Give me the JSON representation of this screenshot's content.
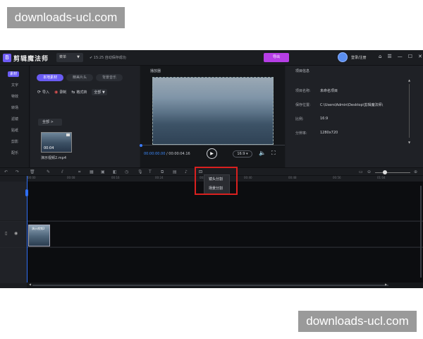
{
  "watermark": {
    "top": "downloads-ucl.com",
    "bottom": "downloads-ucl.com"
  },
  "app": {
    "logo_glyph": "B",
    "title": "剪辑魔法师",
    "menu_label": "菜单",
    "menu_arrow": "▼",
    "autosave": "✔ 15:25 自动保存成功",
    "export_label": "导出",
    "login_label": "登录/注册",
    "window_buttons": [
      "⌂",
      "☰",
      "—",
      "☐",
      "✕"
    ]
  },
  "leftnav": {
    "items": [
      "素材",
      "文字",
      "特效",
      "转场",
      "滤镜",
      "贴纸",
      "剪影",
      "配乐"
    ]
  },
  "media": {
    "tabs": [
      "本地素材",
      "精美片头",
      "背景音乐"
    ],
    "tool_import": "导入",
    "tool_record": "录制",
    "tool_convert": "格式转",
    "tool_all": "全部 ▼",
    "crumb": "全部 >",
    "thumb_duration": "00:04",
    "thumb_name": "演示视频2.mp4"
  },
  "player": {
    "header": "播放器",
    "time_current": "00:00:00.00",
    "time_total": " / 00:00:04.16",
    "play_glyph": "▶",
    "ratio": "16:9 ▾",
    "volume_glyph": "🔈",
    "fullscreen_glyph": "⛶"
  },
  "props": {
    "header": "项目信息",
    "rows": [
      {
        "label": "项目名称:",
        "value": "未命名项目"
      },
      {
        "label": "保存位置:",
        "value": "C:\\Users\\Admin\\Desktop\\剪辑魔法师\\"
      },
      {
        "label": "比例:",
        "value": "16:9"
      },
      {
        "label": "分辨率:",
        "value": "1280x720"
      }
    ]
  },
  "timeline": {
    "ruler_ticks": [
      "00:00",
      "00:08",
      "00:16",
      "00:24",
      "00:32",
      "00:40",
      "00:48",
      "00:56",
      "01:04"
    ],
    "clip_label": "演示视频2",
    "zoom_out": "⊖",
    "zoom_in": "⊕"
  },
  "popup": {
    "items": [
      "镜头分割",
      "场景分割"
    ]
  }
}
